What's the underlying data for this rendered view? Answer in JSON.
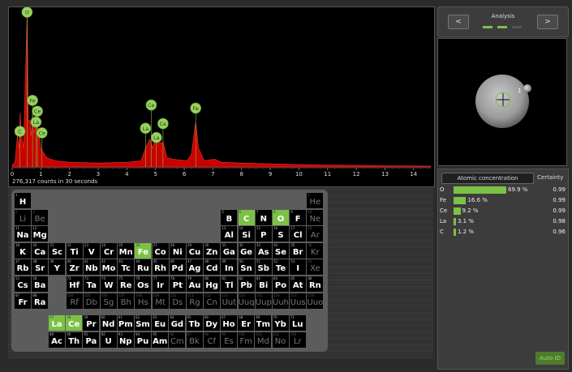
{
  "spectrum": {
    "counts_label": "276,317 counts in 30 seconds",
    "x_ticks": [
      "0",
      "1",
      "2",
      "3",
      "4",
      "5",
      "6",
      "7",
      "8",
      "9",
      "10",
      "11",
      "12",
      "13",
      "14"
    ],
    "peak_labels": [
      "O",
      "Fe",
      "Ce",
      "La",
      "C",
      "Ce",
      "Ce",
      "La",
      "Ce",
      "La",
      "Fe"
    ],
    "chart_data": {
      "type": "area",
      "xlabel": "",
      "ylabel": "",
      "xlim": [
        0,
        14.6
      ],
      "color": "#c80000",
      "points": [
        [
          0.0,
          0.01
        ],
        [
          0.1,
          0.03
        ],
        [
          0.18,
          0.2
        ],
        [
          0.25,
          0.12
        ],
        [
          0.28,
          0.35
        ],
        [
          0.32,
          0.22
        ],
        [
          0.4,
          0.12
        ],
        [
          0.52,
          1.0
        ],
        [
          0.56,
          0.3
        ],
        [
          0.62,
          0.3
        ],
        [
          0.66,
          0.2
        ],
        [
          0.71,
          0.35
        ],
        [
          0.75,
          0.22
        ],
        [
          0.83,
          0.29
        ],
        [
          0.88,
          0.26
        ],
        [
          0.93,
          0.22
        ],
        [
          1.0,
          0.12
        ],
        [
          1.2,
          0.06
        ],
        [
          1.5,
          0.04
        ],
        [
          2.0,
          0.03
        ],
        [
          3.0,
          0.025
        ],
        [
          4.0,
          0.03
        ],
        [
          4.5,
          0.04
        ],
        [
          4.65,
          0.12
        ],
        [
          4.8,
          0.18
        ],
        [
          4.9,
          0.12
        ],
        [
          5.03,
          0.22
        ],
        [
          5.1,
          0.15
        ],
        [
          5.26,
          0.16
        ],
        [
          5.4,
          0.06
        ],
        [
          5.6,
          0.05
        ],
        [
          6.1,
          0.04
        ],
        [
          6.25,
          0.08
        ],
        [
          6.4,
          0.29
        ],
        [
          6.5,
          0.12
        ],
        [
          6.7,
          0.04
        ],
        [
          7.06,
          0.05
        ],
        [
          7.3,
          0.03
        ],
        [
          8.0,
          0.025
        ],
        [
          9.0,
          0.02
        ],
        [
          10.0,
          0.015
        ],
        [
          11.0,
          0.012
        ],
        [
          12.0,
          0.01
        ],
        [
          13.0,
          0.008
        ],
        [
          14.6,
          0.005
        ]
      ],
      "labels": [
        {
          "text": "O",
          "x": 0.52,
          "y": 1.0
        },
        {
          "text": "Fe",
          "x": 0.71,
          "y": 0.43
        },
        {
          "text": "Ce",
          "x": 0.88,
          "y": 0.36
        },
        {
          "text": "La",
          "x": 0.83,
          "y": 0.29
        },
        {
          "text": "C",
          "x": 0.27,
          "y": 0.23
        },
        {
          "text": "Ce",
          "x": 1.04,
          "y": 0.22
        },
        {
          "text": "Ce",
          "x": 4.85,
          "y": 0.4
        },
        {
          "text": "La",
          "x": 4.65,
          "y": 0.25
        },
        {
          "text": "Ce",
          "x": 5.26,
          "y": 0.28
        },
        {
          "text": "La",
          "x": 5.03,
          "y": 0.19
        },
        {
          "text": "Fe",
          "x": 6.4,
          "y": 0.38
        }
      ]
    }
  },
  "periodic_table": {
    "highlight_color": "#7cc145",
    "main": [
      {
        "z": 1,
        "s": "H",
        "r": 0,
        "c": 0,
        "dim": false
      },
      {
        "z": 2,
        "s": "He",
        "r": 0,
        "c": 17,
        "dim": true
      },
      {
        "z": 3,
        "s": "Li",
        "r": 1,
        "c": 0,
        "dim": true
      },
      {
        "z": 4,
        "s": "Be",
        "r": 1,
        "c": 1,
        "dim": true
      },
      {
        "z": 5,
        "s": "B",
        "r": 1,
        "c": 12,
        "dim": false
      },
      {
        "z": 6,
        "s": "C",
        "r": 1,
        "c": 13,
        "dim": false,
        "hl": true
      },
      {
        "z": 7,
        "s": "N",
        "r": 1,
        "c": 14,
        "dim": false
      },
      {
        "z": 8,
        "s": "O",
        "r": 1,
        "c": 15,
        "dim": false,
        "hl": true
      },
      {
        "z": 9,
        "s": "F",
        "r": 1,
        "c": 16,
        "dim": false
      },
      {
        "z": 10,
        "s": "Ne",
        "r": 1,
        "c": 17,
        "dim": true
      },
      {
        "z": 11,
        "s": "Na",
        "r": 2,
        "c": 0,
        "dim": false
      },
      {
        "z": 12,
        "s": "Mg",
        "r": 2,
        "c": 1,
        "dim": false
      },
      {
        "z": 13,
        "s": "Al",
        "r": 2,
        "c": 12,
        "dim": false
      },
      {
        "z": 14,
        "s": "Si",
        "r": 2,
        "c": 13,
        "dim": false
      },
      {
        "z": 15,
        "s": "P",
        "r": 2,
        "c": 14,
        "dim": false
      },
      {
        "z": 16,
        "s": "S",
        "r": 2,
        "c": 15,
        "dim": false
      },
      {
        "z": 17,
        "s": "Cl",
        "r": 2,
        "c": 16,
        "dim": false
      },
      {
        "z": 18,
        "s": "Ar",
        "r": 2,
        "c": 17,
        "dim": true
      },
      {
        "z": 19,
        "s": "K",
        "r": 3,
        "c": 0,
        "dim": false
      },
      {
        "z": 20,
        "s": "Ca",
        "r": 3,
        "c": 1,
        "dim": false
      },
      {
        "z": 21,
        "s": "Sc",
        "r": 3,
        "c": 2,
        "dim": false
      },
      {
        "z": 22,
        "s": "Ti",
        "r": 3,
        "c": 3,
        "dim": false
      },
      {
        "z": 23,
        "s": "V",
        "r": 3,
        "c": 4,
        "dim": false
      },
      {
        "z": 24,
        "s": "Cr",
        "r": 3,
        "c": 5,
        "dim": false
      },
      {
        "z": 25,
        "s": "Mn",
        "r": 3,
        "c": 6,
        "dim": false
      },
      {
        "z": 26,
        "s": "Fe",
        "r": 3,
        "c": 7,
        "dim": false,
        "hl": true
      },
      {
        "z": 27,
        "s": "Co",
        "r": 3,
        "c": 8,
        "dim": false
      },
      {
        "z": 28,
        "s": "Ni",
        "r": 3,
        "c": 9,
        "dim": false
      },
      {
        "z": 29,
        "s": "Cu",
        "r": 3,
        "c": 10,
        "dim": false
      },
      {
        "z": 30,
        "s": "Zn",
        "r": 3,
        "c": 11,
        "dim": false
      },
      {
        "z": 31,
        "s": "Ga",
        "r": 3,
        "c": 12,
        "dim": false
      },
      {
        "z": 32,
        "s": "Ge",
        "r": 3,
        "c": 13,
        "dim": false
      },
      {
        "z": 33,
        "s": "As",
        "r": 3,
        "c": 14,
        "dim": false
      },
      {
        "z": 34,
        "s": "Se",
        "r": 3,
        "c": 15,
        "dim": false
      },
      {
        "z": 35,
        "s": "Br",
        "r": 3,
        "c": 16,
        "dim": false
      },
      {
        "z": 36,
        "s": "Kr",
        "r": 3,
        "c": 17,
        "dim": true
      },
      {
        "z": 37,
        "s": "Rb",
        "r": 4,
        "c": 0,
        "dim": false
      },
      {
        "z": 38,
        "s": "Sr",
        "r": 4,
        "c": 1,
        "dim": false
      },
      {
        "z": 39,
        "s": "Y",
        "r": 4,
        "c": 2,
        "dim": false
      },
      {
        "z": 40,
        "s": "Zr",
        "r": 4,
        "c": 3,
        "dim": false
      },
      {
        "z": 41,
        "s": "Nb",
        "r": 4,
        "c": 4,
        "dim": false
      },
      {
        "z": 42,
        "s": "Mo",
        "r": 4,
        "c": 5,
        "dim": false
      },
      {
        "z": 43,
        "s": "Tc",
        "r": 4,
        "c": 6,
        "dim": false
      },
      {
        "z": 44,
        "s": "Ru",
        "r": 4,
        "c": 7,
        "dim": false
      },
      {
        "z": 45,
        "s": "Rh",
        "r": 4,
        "c": 8,
        "dim": false
      },
      {
        "z": 46,
        "s": "Pd",
        "r": 4,
        "c": 9,
        "dim": false
      },
      {
        "z": 47,
        "s": "Ag",
        "r": 4,
        "c": 10,
        "dim": false
      },
      {
        "z": 48,
        "s": "Cd",
        "r": 4,
        "c": 11,
        "dim": false
      },
      {
        "z": 49,
        "s": "In",
        "r": 4,
        "c": 12,
        "dim": false
      },
      {
        "z": 50,
        "s": "Sn",
        "r": 4,
        "c": 13,
        "dim": false
      },
      {
        "z": 51,
        "s": "Sb",
        "r": 4,
        "c": 14,
        "dim": false
      },
      {
        "z": 52,
        "s": "Te",
        "r": 4,
        "c": 15,
        "dim": false
      },
      {
        "z": 53,
        "s": "I",
        "r": 4,
        "c": 16,
        "dim": false
      },
      {
        "z": 54,
        "s": "Xe",
        "r": 4,
        "c": 17,
        "dim": true
      },
      {
        "z": 55,
        "s": "Cs",
        "r": 5,
        "c": 0,
        "dim": false
      },
      {
        "z": 56,
        "s": "Ba",
        "r": 5,
        "c": 1,
        "dim": false
      },
      {
        "z": 72,
        "s": "Hf",
        "r": 5,
        "c": 3,
        "dim": false
      },
      {
        "z": 73,
        "s": "Ta",
        "r": 5,
        "c": 4,
        "dim": false
      },
      {
        "z": 74,
        "s": "W",
        "r": 5,
        "c": 5,
        "dim": false
      },
      {
        "z": 75,
        "s": "Re",
        "r": 5,
        "c": 6,
        "dim": false
      },
      {
        "z": 76,
        "s": "Os",
        "r": 5,
        "c": 7,
        "dim": false
      },
      {
        "z": 77,
        "s": "Ir",
        "r": 5,
        "c": 8,
        "dim": false
      },
      {
        "z": 78,
        "s": "Pt",
        "r": 5,
        "c": 9,
        "dim": false
      },
      {
        "z": 79,
        "s": "Au",
        "r": 5,
        "c": 10,
        "dim": false
      },
      {
        "z": 80,
        "s": "Hg",
        "r": 5,
        "c": 11,
        "dim": false
      },
      {
        "z": 81,
        "s": "Tl",
        "r": 5,
        "c": 12,
        "dim": false
      },
      {
        "z": 82,
        "s": "Pb",
        "r": 5,
        "c": 13,
        "dim": false
      },
      {
        "z": 83,
        "s": "Bi",
        "r": 5,
        "c": 14,
        "dim": false
      },
      {
        "z": 84,
        "s": "Po",
        "r": 5,
        "c": 15,
        "dim": false
      },
      {
        "z": 85,
        "s": "At",
        "r": 5,
        "c": 16,
        "dim": false
      },
      {
        "z": 86,
        "s": "Rn",
        "r": 5,
        "c": 17,
        "dim": false
      },
      {
        "z": 87,
        "s": "Fr",
        "r": 6,
        "c": 0,
        "dim": false
      },
      {
        "z": 88,
        "s": "Ra",
        "r": 6,
        "c": 1,
        "dim": false
      },
      {
        "z": 104,
        "s": "Rf",
        "r": 6,
        "c": 3,
        "dim": true
      },
      {
        "z": 105,
        "s": "Db",
        "r": 6,
        "c": 4,
        "dim": true
      },
      {
        "z": 106,
        "s": "Sg",
        "r": 6,
        "c": 5,
        "dim": true
      },
      {
        "z": 107,
        "s": "Bh",
        "r": 6,
        "c": 6,
        "dim": true
      },
      {
        "z": 108,
        "s": "Hs",
        "r": 6,
        "c": 7,
        "dim": true
      },
      {
        "z": 109,
        "s": "Mt",
        "r": 6,
        "c": 8,
        "dim": true
      },
      {
        "z": 110,
        "s": "Ds",
        "r": 6,
        "c": 9,
        "dim": true
      },
      {
        "z": 111,
        "s": "Rg",
        "r": 6,
        "c": 10,
        "dim": true
      },
      {
        "z": 112,
        "s": "Cn",
        "r": 6,
        "c": 11,
        "dim": true
      },
      {
        "z": 113,
        "s": "Uut",
        "r": 6,
        "c": 12,
        "dim": true
      },
      {
        "z": 114,
        "s": "Uuq",
        "r": 6,
        "c": 13,
        "dim": true
      },
      {
        "z": 115,
        "s": "Uup",
        "r": 6,
        "c": 14,
        "dim": true
      },
      {
        "z": 116,
        "s": "Uuh",
        "r": 6,
        "c": 15,
        "dim": true
      },
      {
        "z": 117,
        "s": "Uus",
        "r": 6,
        "c": 16,
        "dim": true
      },
      {
        "z": 118,
        "s": "Uuo",
        "r": 6,
        "c": 17,
        "dim": true
      }
    ],
    "f_block": [
      {
        "z": 57,
        "s": "La",
        "r": 0,
        "c": 0,
        "dim": false,
        "hl": true
      },
      {
        "z": 58,
        "s": "Ce",
        "r": 0,
        "c": 1,
        "dim": false,
        "hl": true
      },
      {
        "z": 59,
        "s": "Pr",
        "r": 0,
        "c": 2,
        "dim": false
      },
      {
        "z": 60,
        "s": "Nd",
        "r": 0,
        "c": 3,
        "dim": false
      },
      {
        "z": 61,
        "s": "Pm",
        "r": 0,
        "c": 4,
        "dim": false
      },
      {
        "z": 62,
        "s": "Sm",
        "r": 0,
        "c": 5,
        "dim": false
      },
      {
        "z": 63,
        "s": "Eu",
        "r": 0,
        "c": 6,
        "dim": false
      },
      {
        "z": 64,
        "s": "Gd",
        "r": 0,
        "c": 7,
        "dim": false
      },
      {
        "z": 65,
        "s": "Tb",
        "r": 0,
        "c": 8,
        "dim": false
      },
      {
        "z": 66,
        "s": "Dy",
        "r": 0,
        "c": 9,
        "dim": false
      },
      {
        "z": 67,
        "s": "Ho",
        "r": 0,
        "c": 10,
        "dim": false
      },
      {
        "z": 68,
        "s": "Er",
        "r": 0,
        "c": 11,
        "dim": false
      },
      {
        "z": 69,
        "s": "Tm",
        "r": 0,
        "c": 12,
        "dim": false
      },
      {
        "z": 70,
        "s": "Yb",
        "r": 0,
        "c": 13,
        "dim": false
      },
      {
        "z": 71,
        "s": "Lu",
        "r": 0,
        "c": 14,
        "dim": false
      },
      {
        "z": 89,
        "s": "Ac",
        "r": 1,
        "c": 0,
        "dim": false
      },
      {
        "z": 90,
        "s": "Th",
        "r": 1,
        "c": 1,
        "dim": false
      },
      {
        "z": 91,
        "s": "Pa",
        "r": 1,
        "c": 2,
        "dim": false
      },
      {
        "z": 92,
        "s": "U",
        "r": 1,
        "c": 3,
        "dim": false
      },
      {
        "z": 93,
        "s": "Np",
        "r": 1,
        "c": 4,
        "dim": false
      },
      {
        "z": 94,
        "s": "Pu",
        "r": 1,
        "c": 5,
        "dim": false
      },
      {
        "z": 95,
        "s": "Am",
        "r": 1,
        "c": 6,
        "dim": false
      },
      {
        "z": 96,
        "s": "Cm",
        "r": 1,
        "c": 7,
        "dim": true
      },
      {
        "z": 97,
        "s": "Bk",
        "r": 1,
        "c": 8,
        "dim": true
      },
      {
        "z": 98,
        "s": "Cf",
        "r": 1,
        "c": 9,
        "dim": true
      },
      {
        "z": 99,
        "s": "Es",
        "r": 1,
        "c": 10,
        "dim": true
      },
      {
        "z": 100,
        "s": "Fm",
        "r": 1,
        "c": 11,
        "dim": true
      },
      {
        "z": 101,
        "s": "Md",
        "r": 1,
        "c": 12,
        "dim": true
      },
      {
        "z": 102,
        "s": "No",
        "r": 1,
        "c": 13,
        "dim": true
      },
      {
        "z": 103,
        "s": "Lr",
        "r": 1,
        "c": 14,
        "dim": true
      }
    ]
  },
  "nav": {
    "prev_label": "<",
    "next_label": ">",
    "title": "Analysis",
    "indicator_states": [
      true,
      true,
      false
    ],
    "accent": "#7cc145"
  },
  "image_view": {
    "marker_label": "1"
  },
  "results": {
    "concentration_header": "Atomic concentration",
    "certainty_header": "Certainty",
    "rows": [
      {
        "element": "O",
        "percent": "69.9 %",
        "value": 69.9,
        "certainty": "0.99"
      },
      {
        "element": "Fe",
        "percent": "16.6 %",
        "value": 16.6,
        "certainty": "0.99"
      },
      {
        "element": "Ce",
        "percent": "9.2 %",
        "value": 9.2,
        "certainty": "0.99"
      },
      {
        "element": "La",
        "percent": "3.1 %",
        "value": 3.1,
        "certainty": "0.98"
      },
      {
        "element": "C",
        "percent": "1.2 %",
        "value": 1.2,
        "certainty": "0.96"
      }
    ],
    "auto_id_label": "Auto ID"
  }
}
